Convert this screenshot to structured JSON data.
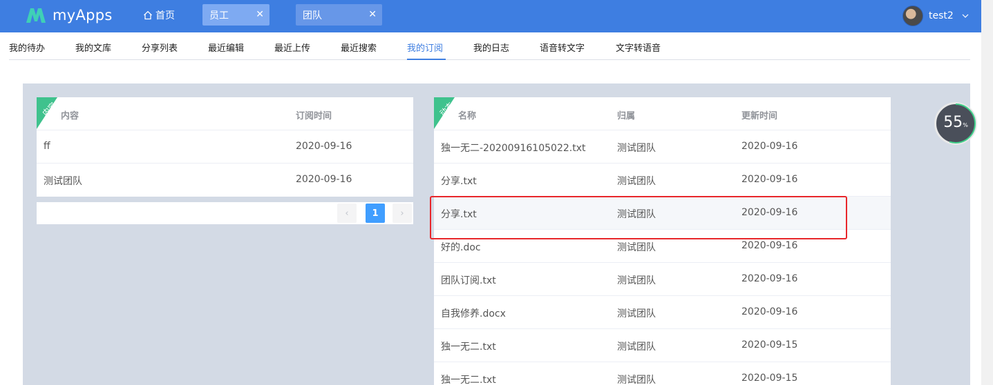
{
  "header": {
    "logo_text": "myApps",
    "home_label": "首页",
    "tabs": [
      {
        "label": "员工",
        "close": "✕",
        "active": true
      },
      {
        "label": "团队",
        "close": "✕",
        "active": false
      }
    ],
    "user_name": "test2",
    "accent": "#3e7ee1"
  },
  "subnav": {
    "items": [
      "我的待办",
      "我的文库",
      "分享列表",
      "最近编辑",
      "最近上传",
      "最近搜索",
      "我的订阅",
      "我的日志",
      "语音转文字",
      "文字转语音"
    ],
    "active_index": 6
  },
  "left_panel": {
    "ribbon": "内容",
    "columns": [
      "内容",
      "订阅时间"
    ],
    "rows": [
      [
        "ff",
        "2020-09-16"
      ],
      [
        "测试团队",
        "2020-09-16"
      ]
    ],
    "pager": {
      "current": "1",
      "prev": "‹",
      "next": "›"
    }
  },
  "right_panel": {
    "ribbon": "动态",
    "columns": [
      "名称",
      "归属",
      "更新时间"
    ],
    "rows": [
      [
        "独一无二-20200916105022.txt",
        "测试团队",
        "2020-09-16"
      ],
      [
        "分享.txt",
        "测试团队",
        "2020-09-16"
      ],
      [
        "分享.txt",
        "测试团队",
        "2020-09-16"
      ],
      [
        "好的.doc",
        "测试团队",
        "2020-09-16"
      ],
      [
        "团队订阅.txt",
        "测试团队",
        "2020-09-16"
      ],
      [
        "自我修养.docx",
        "测试团队",
        "2020-09-16"
      ],
      [
        "独一无二.txt",
        "测试团队",
        "2020-09-15"
      ],
      [
        "独一无二.txt",
        "测试团队",
        "2020-09-15"
      ]
    ],
    "highlight_row": 2
  },
  "gauge": {
    "value": "55",
    "unit": "%",
    "fraction": 0.55
  }
}
